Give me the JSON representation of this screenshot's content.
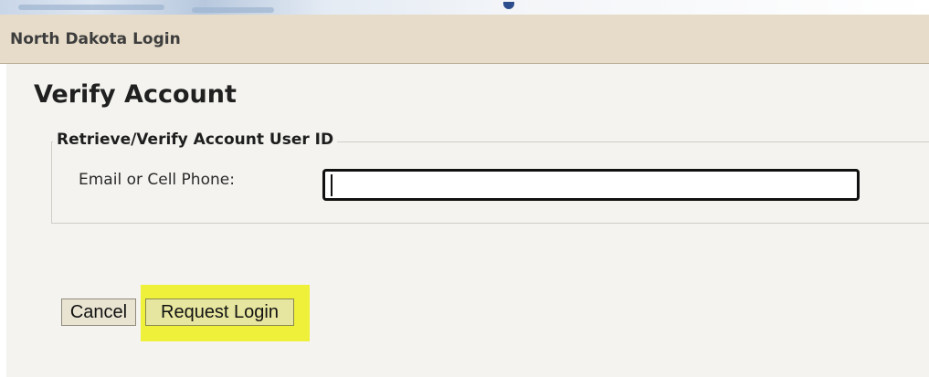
{
  "header": {
    "title": "North Dakota Login"
  },
  "main": {
    "page_title": "Verify Account",
    "fieldset": {
      "legend": "Retrieve/Verify Account User ID",
      "email_label": "Email or Cell Phone:",
      "email_value": ""
    },
    "buttons": {
      "cancel_label": "Cancel",
      "request_label": "Request Login"
    }
  },
  "colors": {
    "header_bg": "#e6dcc9",
    "content_bg": "#f4f3ef",
    "highlight": "#eef03a"
  }
}
